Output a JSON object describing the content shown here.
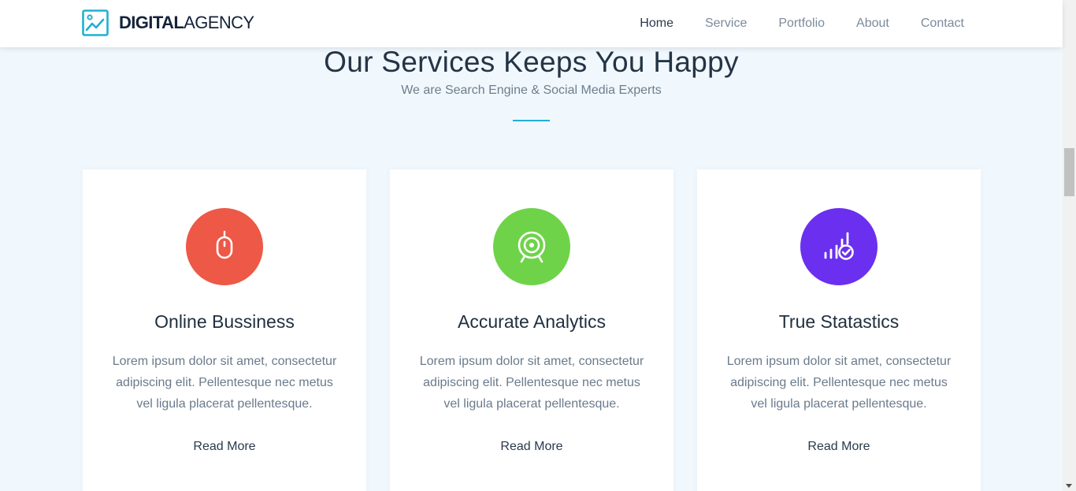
{
  "brand": {
    "bold": "DIGITAL",
    "light": "AGENCY",
    "logo_icon": "chart-line-icon"
  },
  "nav": {
    "items": [
      "Home",
      "Service",
      "Portfolio",
      "About",
      "Contact"
    ],
    "active": "Home"
  },
  "section": {
    "title": "Our Services Keeps You Happy",
    "subtitle": "We are Search Engine & Social Media Experts",
    "accent_color": "#1fb0d4"
  },
  "cards": [
    {
      "icon": "mouse-icon",
      "color": "#ed5847",
      "title": "Online Bussiness",
      "text": "Lorem ipsum dolor sit amet, consectetur adipiscing elit. Pellentesque nec metus vel ligula placerat pellentesque.",
      "link": "Read More"
    },
    {
      "icon": "target-icon",
      "color": "#6fd34a",
      "title": "Accurate Analytics",
      "text": "Lorem ipsum dolor sit amet, consectetur adipiscing elit. Pellentesque nec metus vel ligula placerat pellentesque.",
      "link": "Read More"
    },
    {
      "icon": "stats-check-icon",
      "color": "#6b2ff0",
      "title": "True Statastics",
      "text": "Lorem ipsum dolor sit amet, consectetur adipiscing elit. Pellentesque nec metus vel ligula placerat pellentesque.",
      "link": "Read More"
    }
  ]
}
